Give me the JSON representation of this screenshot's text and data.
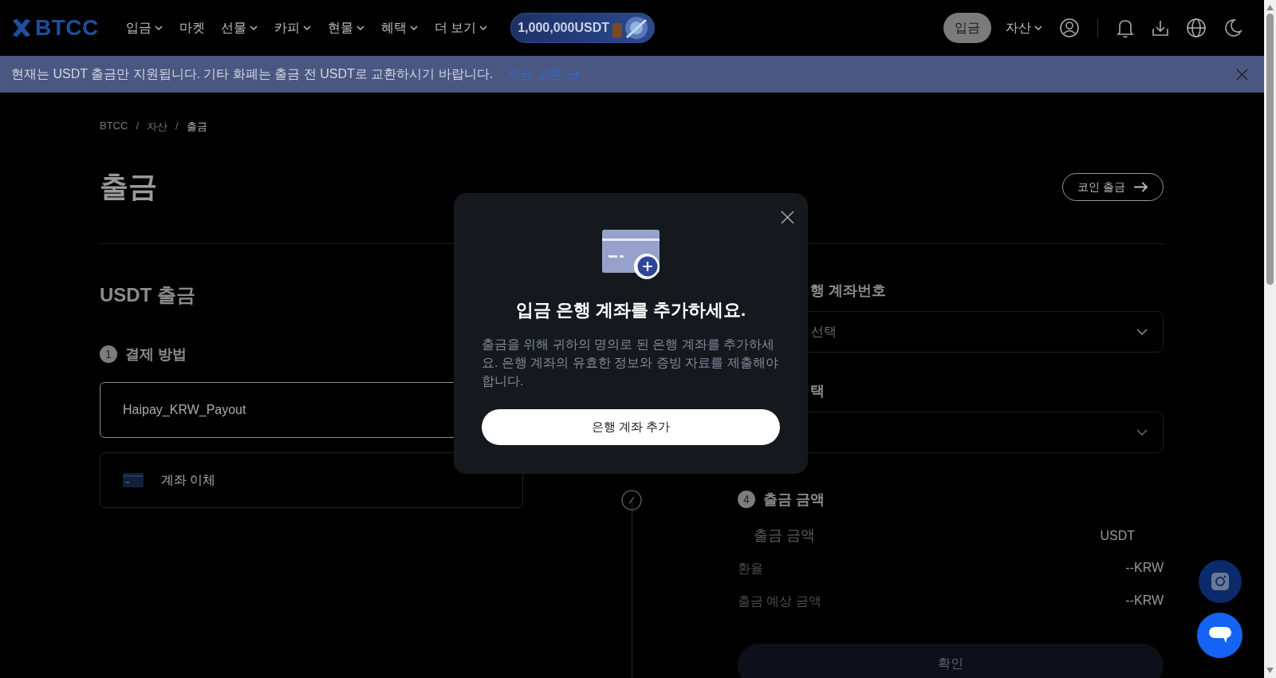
{
  "header": {
    "logo": "BTCC",
    "nav": [
      {
        "label": "입금",
        "dropdown": true
      },
      {
        "label": "마켓",
        "dropdown": false
      },
      {
        "label": "선물",
        "dropdown": true
      },
      {
        "label": "카피",
        "dropdown": true
      },
      {
        "label": "현물",
        "dropdown": true
      },
      {
        "label": "혜택",
        "dropdown": true
      },
      {
        "label": "더 보기",
        "dropdown": true
      }
    ],
    "promo": "1,000,000USDT",
    "deposit_button": "입금",
    "assets_menu": "자산"
  },
  "notice": {
    "text": "현재는 USDT 출금만 지원됩니다. 기타 화폐는 출금 전 USDT로 교환하시기 바랍니다.",
    "link": "지금 교환"
  },
  "breadcrumb": [
    {
      "label": "BTCC",
      "kind": "link"
    },
    {
      "label": "/",
      "kind": "separator"
    },
    {
      "label": "자산",
      "kind": "link"
    },
    {
      "label": "/",
      "kind": "separator"
    },
    {
      "label": "출금",
      "kind": "current"
    }
  ],
  "page_title": "출금",
  "coin_withdraw_button": "코인 출금",
  "section_title": "USDT 출금",
  "step_1": {
    "number": "1",
    "title": "결제 방법"
  },
  "payment_methods": [
    {
      "label": "Haipay_KRW_Payout",
      "kind": "plain",
      "selected": true
    },
    {
      "label": "계좌 이체",
      "kind": "card",
      "selected": false
    }
  ],
  "account_label": "행 계좌번호",
  "account_select": "선택",
  "step_3_label": "택",
  "step_4": {
    "number": "4",
    "title": "출금 금액"
  },
  "amount": {
    "placeholder": "출금 금액",
    "unit": "USDT"
  },
  "summary": [
    {
      "label": "환율",
      "value": "--KRW"
    },
    {
      "label": "출금 예상 금액",
      "value": "--KRW"
    }
  ],
  "confirm_button": "확인",
  "modal": {
    "title": "입금 은행 계좌를 추가하세요.",
    "description": "출금을 위해 귀하의 명의로 된 은행 계좌를 추가하세요. 은행 계좌의 유효한 정보와 증빙 자료를 제출해야 합니다.",
    "button": "은행 계좌 추가"
  }
}
